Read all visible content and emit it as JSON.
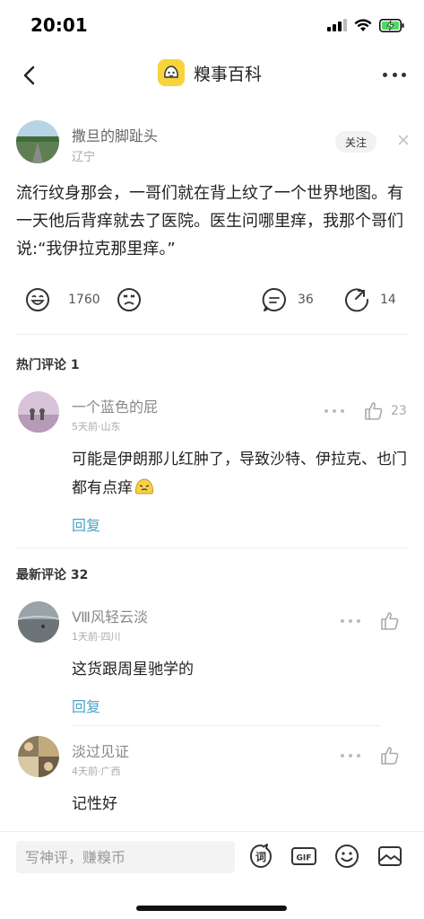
{
  "status_bar": {
    "time": "20:01"
  },
  "nav": {
    "title": "糗事百科"
  },
  "post": {
    "author_name": "撒旦的脚趾头",
    "author_location": "辽宁",
    "follow_label": "关注",
    "text": "流行纹身那会，一哥们就在背上纹了一个世界地图。有一天他后背痒就去了医院。医生问哪里痒，我那个哥们说:“我伊拉克那里痒。”",
    "like_count": "1760",
    "comment_count": "36",
    "share_count": "14"
  },
  "hot_comments": {
    "title": "热门评论 1",
    "items": [
      {
        "name": "一个蓝色的屁",
        "meta": "5天前·山东",
        "text": "可能是伊朗那儿红肿了，导致沙特、伊拉克、也门都有点痒",
        "like_count": "23",
        "reply_label": "回复"
      }
    ]
  },
  "latest_comments": {
    "title": "最新评论 32",
    "items": [
      {
        "name": "Ⅷ风轻云淡",
        "meta": "1天前·四川",
        "text": "这货跟周星驰学的",
        "reply_label": "回复"
      },
      {
        "name": "淡过见证",
        "meta": "4天前·广西",
        "text": "记性好"
      }
    ]
  },
  "bottom_bar": {
    "input_placeholder": "写神评，赚糗币",
    "word_icon_label": "词",
    "gif_label": "GIF"
  },
  "colors": {
    "accent_yellow": "#f7d33c",
    "reply_blue": "#4aa3c8",
    "battery_green": "#4cd964"
  }
}
